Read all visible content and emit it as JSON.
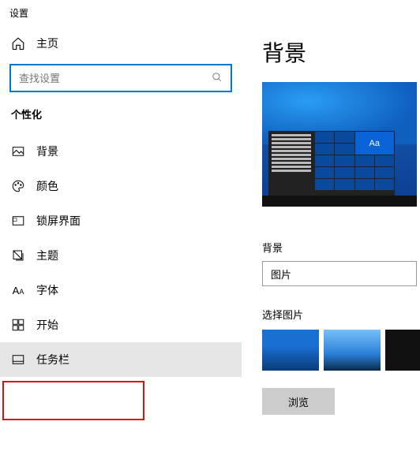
{
  "window_title": "设置",
  "home_label": "主页",
  "search_placeholder": "查找设置",
  "category": "个性化",
  "nav": [
    {
      "label": "背景",
      "icon": "image-icon"
    },
    {
      "label": "颜色",
      "icon": "palette-icon"
    },
    {
      "label": "锁屏界面",
      "icon": "lock-icon"
    },
    {
      "label": "主题",
      "icon": "theme-icon"
    },
    {
      "label": "字体",
      "icon": "font-icon"
    },
    {
      "label": "开始",
      "icon": "start-icon"
    },
    {
      "label": "任务栏",
      "icon": "taskbar-icon"
    }
  ],
  "page_title": "背景",
  "preview_tile_text": "Aa",
  "bg_section_label": "背景",
  "bg_combo_value": "图片",
  "choose_label": "选择图片",
  "browse_label": "浏览"
}
